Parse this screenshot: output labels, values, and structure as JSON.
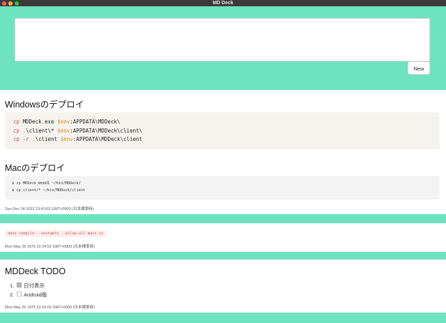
{
  "window": {
    "title": "MD Deck"
  },
  "editor": {
    "value": "",
    "placeholder": ""
  },
  "toolbar": {
    "new_label": "New"
  },
  "cards": [
    {
      "sections": [
        {
          "heading": "Windowsのデプロイ",
          "code_lines": [
            [
              {
                "t": "cp",
                "c": "kw"
              },
              {
                "t": " MDDeck",
                "c": ""
              },
              {
                "t": ".",
                "c": "kw"
              },
              {
                "t": "exe ",
                "c": ""
              },
              {
                "t": "$env",
                "c": "var"
              },
              {
                "t": ":APPDATA\\MDDeck\\",
                "c": ""
              }
            ],
            [
              {
                "t": "cp",
                "c": "kw"
              },
              {
                "t": " ",
                "c": ""
              },
              {
                "t": ".",
                "c": "kw"
              },
              {
                "t": "\\client\\* ",
                "c": ""
              },
              {
                "t": "$env",
                "c": "var"
              },
              {
                "t": ":APPDATA\\MDDeck\\client\\",
                "c": ""
              }
            ],
            [
              {
                "t": "cp",
                "c": "kw"
              },
              {
                "t": " ",
                "c": ""
              },
              {
                "t": "-r",
                "c": "kw"
              },
              {
                "t": " ",
                "c": ""
              },
              {
                "t": ".",
                "c": "kw"
              },
              {
                "t": "\\client ",
                "c": ""
              },
              {
                "t": "$env",
                "c": "var"
              },
              {
                "t": ":APPDATA\\MDDeck\\client",
                "c": ""
              }
            ]
          ]
        },
        {
          "heading": "Macのデプロイ",
          "code_lines": [
            "$ cp MDDeck_WebUI ~/bin/MDDeck/",
            "$ cp client/* ~/bin/MDDeck/client"
          ]
        }
      ],
      "timestamp": "Sun Dec 24 2023 23:43:02 GMT+0900 (日本標準時)"
    },
    {
      "inline_code": "deno compile --unstable --allow-all main.ts",
      "timestamp": "Mon May 26 1975 22:24:52 GMT+0900 (日本標準時)"
    },
    {
      "heading": "MDDeck TODO",
      "todos": [
        {
          "num": "1.",
          "label": "日付表示",
          "checked": true
        },
        {
          "num": "2.",
          "label": "Android版",
          "checked": false
        }
      ],
      "timestamp": "Mon May 26 1975 22:16:03 GMT+0900 (日本標準時)"
    }
  ]
}
